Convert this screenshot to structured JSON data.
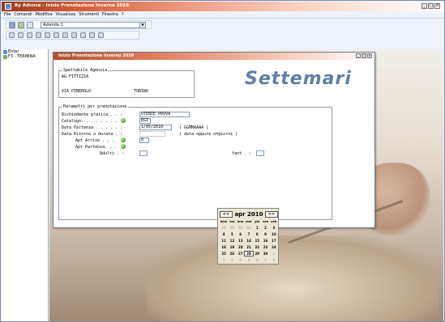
{
  "window": {
    "title": "By Advnce - Inizio Prenotazione Inverno 2010"
  },
  "menu": [
    "File",
    "Comandi",
    "Modifica",
    "Visualizza",
    "Strumenti",
    "Finestra",
    "?"
  ],
  "toolbar": {
    "company": "Azienda 1"
  },
  "tree": {
    "items": [
      "Enter",
      "F3 - TERMINA"
    ]
  },
  "dialog": {
    "title": "Inizio Prenotazione Inverno 2010",
    "agency": {
      "label": "Spettabile Agenzia",
      "name": "AG FITTIZIA",
      "address": "VIA PINEROLO",
      "city": "TORINO"
    },
    "logo": "Settemari",
    "params": {
      "label": "Parametri per prenotazione",
      "richiedente_label": "Richiedente pratica . . :",
      "richiedente_value": "UTENTE PROVA",
      "catalogo_label": "Catalogo. . . . . . . .",
      "catalogo_value": "EGI",
      "data_partenza_label": "Data Partenza . . . . . :",
      "data_partenza_value": "1/05/2010",
      "data_partenza_hint": "( GGMMAAAA )",
      "ritorno_label": "Data Ritorno o durata . :",
      "ritorno_hint": "( data oppure n=giorni )",
      "apt_arrivo_label": "Apt Arrivo . . .",
      "apt_arrivo_value": "0",
      "apt_partenza_label": "Apt Partenza. . .",
      "adulti_label": "Adulti . :",
      "infant_label": "fant . :"
    },
    "calendar": {
      "prev": "<<",
      "next": ">>",
      "month": "apr 2010",
      "days": [
        "dom",
        "lun",
        "mar",
        "mer",
        "gio",
        "ven",
        "sab"
      ],
      "weeks": [
        [
          "28",
          "29",
          "30",
          "31",
          "1",
          "2",
          "3"
        ],
        [
          "4",
          "5",
          "6",
          "7",
          "8",
          "9",
          "10"
        ],
        [
          "11",
          "12",
          "13",
          "14",
          "15",
          "16",
          "17"
        ],
        [
          "18",
          "19",
          "20",
          "21",
          "22",
          "23",
          "24"
        ],
        [
          "25",
          "26",
          "27",
          "28",
          "29",
          "30",
          "1"
        ],
        [
          "2",
          "3",
          "4",
          "5",
          "6",
          "7",
          "8"
        ]
      ],
      "selected": "28"
    }
  }
}
